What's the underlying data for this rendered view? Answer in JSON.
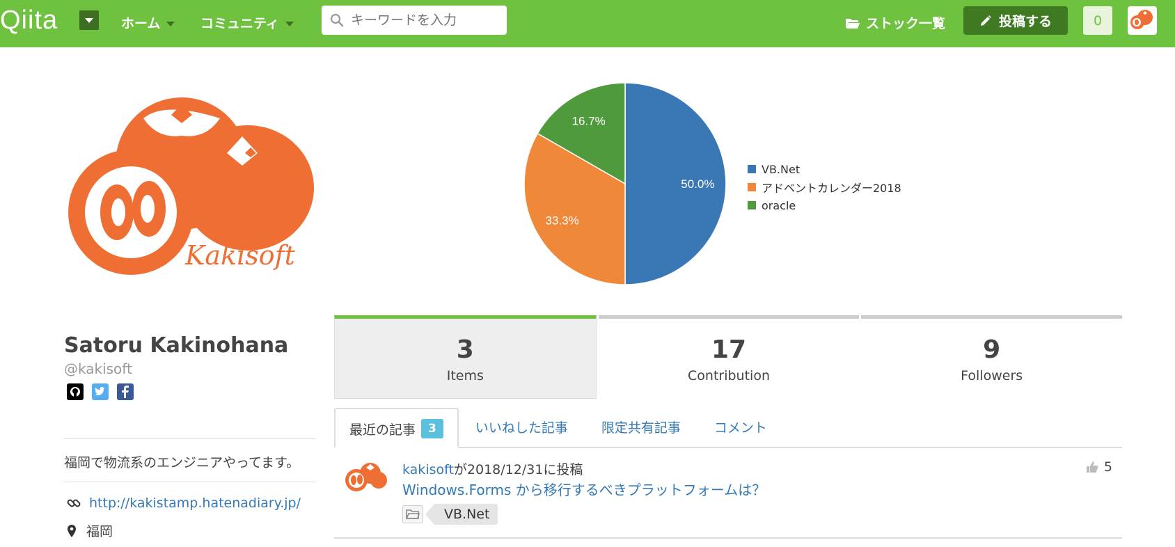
{
  "header": {
    "logo": "Qiita",
    "nav": [
      {
        "label": "ホーム"
      },
      {
        "label": "コミュニティ"
      }
    ],
    "search_placeholder": "キーワードを入力",
    "stock_label": "ストック一覧",
    "post_label": "投稿する",
    "notification_count": "0"
  },
  "profile": {
    "name": "Satoru Kakinohana",
    "handle": "@kakisoft",
    "bio": "福岡で物流系のエンジニアやってます。",
    "website": "http://kakistamp.hatenadiary.jp/",
    "location": "福岡",
    "logo_text": "Kakisoft"
  },
  "chart_data": {
    "type": "pie",
    "categories": [
      "VB.Net",
      "アドベントカレンダー2018",
      "oracle"
    ],
    "values": [
      50.0,
      33.3,
      16.7
    ],
    "labels": [
      "50.0%",
      "33.3%",
      "16.7%"
    ],
    "colors": [
      "#3a78b5",
      "#f0883a",
      "#4e9a3d"
    ],
    "legend_position": "right"
  },
  "stats": [
    {
      "value": "3",
      "label": "Items"
    },
    {
      "value": "17",
      "label": "Contribution"
    },
    {
      "value": "9",
      "label": "Followers"
    }
  ],
  "tabs": [
    {
      "label": "最近の記事",
      "badge": "3"
    },
    {
      "label": "いいねした記事"
    },
    {
      "label": "限定共有記事"
    },
    {
      "label": "コメント"
    }
  ],
  "articles": [
    {
      "author": "kakisoft",
      "meta_suffix": "が2018/12/31に投稿",
      "title": "Windows.Forms から移行するべきプラットフォームは？",
      "tag": "VB.Net",
      "likes": "5"
    }
  ],
  "colors": {
    "brand": "#6fc23f",
    "brand_dark": "#3f7a22",
    "link": "#337ab7",
    "kaki": "#ef6e33"
  }
}
